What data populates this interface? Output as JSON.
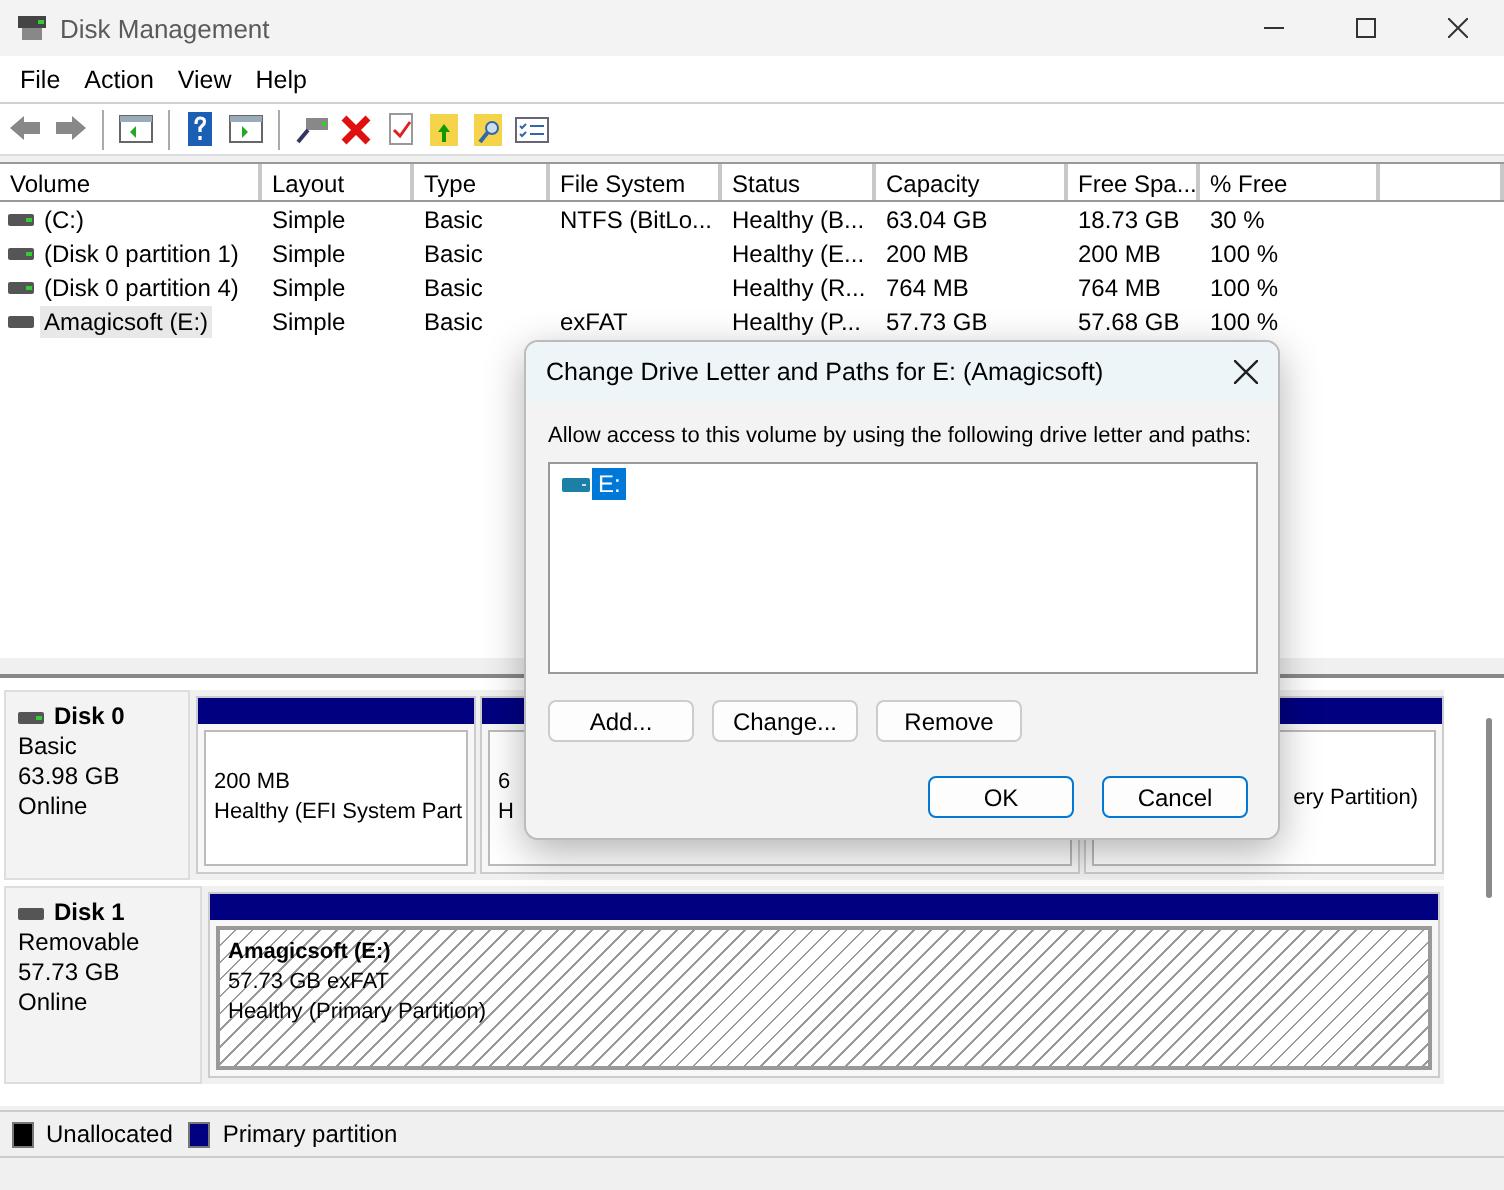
{
  "window": {
    "title": "Disk Management"
  },
  "menu": [
    "File",
    "Action",
    "View",
    "Help"
  ],
  "table": {
    "columns": [
      "Volume",
      "Layout",
      "Type",
      "File System",
      "Status",
      "Capacity",
      "Free Spa...",
      "% Free"
    ],
    "rows": [
      {
        "cells": [
          "(C:)",
          "Simple",
          "Basic",
          "NTFS (BitLo...",
          "Healthy (B...",
          "63.04 GB",
          "18.73 GB",
          "30 %"
        ],
        "selected": false
      },
      {
        "cells": [
          "(Disk 0 partition 1)",
          "Simple",
          "Basic",
          "",
          "Healthy (E...",
          "200 MB",
          "200 MB",
          "100 %"
        ],
        "selected": false
      },
      {
        "cells": [
          "(Disk 0 partition 4)",
          "Simple",
          "Basic",
          "",
          "Healthy (R...",
          "764 MB",
          "764 MB",
          "100 %"
        ],
        "selected": false
      },
      {
        "cells": [
          "Amagicsoft (E:)",
          "Simple",
          "Basic",
          "exFAT",
          "Healthy (P...",
          "57.73 GB",
          "57.68 GB",
          "100 %"
        ],
        "selected": true
      }
    ]
  },
  "disks": [
    {
      "name": "Disk 0",
      "details": [
        "Basic",
        "63.98 GB",
        "Online"
      ],
      "partitions": [
        {
          "lines": [
            "200 MB",
            "Healthy (EFI System Part"
          ],
          "selected": false
        },
        {
          "lines": [
            "6",
            "H"
          ],
          "selected": false
        },
        {
          "lines": [
            "ery Partition)"
          ],
          "selected": false
        }
      ]
    },
    {
      "name": "Disk 1",
      "details": [
        "Removable",
        "57.73 GB",
        "Online"
      ],
      "partitions": [
        {
          "label": "Amagicsoft  (E:)",
          "lines": [
            "57.73 GB exFAT",
            "Healthy (Primary Partition)"
          ],
          "selected": true
        }
      ]
    }
  ],
  "legend": [
    {
      "label": "Unallocated",
      "color": "#000000"
    },
    {
      "label": "Primary partition",
      "color": "#000080"
    }
  ],
  "dialog": {
    "title": "Change Drive Letter and Paths for E: (Amagicsoft)",
    "prompt": "Allow access to this volume by using the following drive letter and paths:",
    "paths": [
      {
        "text": "E:",
        "selected": true
      }
    ],
    "actions": [
      "Add...",
      "Change...",
      "Remove"
    ],
    "buttons": [
      "OK",
      "Cancel"
    ]
  }
}
